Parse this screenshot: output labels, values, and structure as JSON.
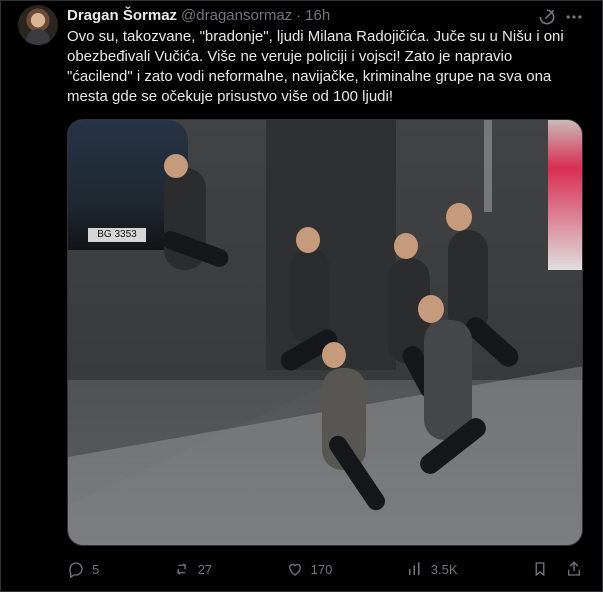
{
  "post": {
    "author_name": "Dragan Šormaz",
    "author_handle": "@dragansormaz",
    "separator": "·",
    "time": "16h",
    "text_lines": [
      "Ovo su, takozvane, \"bradonje\", ljudi Milana Radojičića. Juče su u Nišu i oni",
      "obezbeđivali Vučića. Više ne veruje policiji i vojsci! Zato je napravio",
      "\"ćacilend\" i zato vodi neformalne, navijačke, kriminalne grupe na sva ona",
      "mesta gde se očekuje prisustvo više od 100 ljudi!"
    ],
    "media_plate": "BG 3353"
  },
  "actions": {
    "replies": "5",
    "reposts": "27",
    "likes": "170",
    "views": "3.5K"
  },
  "icons": {
    "grok": "grok-icon",
    "more": "more-icon",
    "reply": "reply-icon",
    "repost": "repost-icon",
    "like": "heart-icon",
    "views": "views-icon",
    "bookmark": "bookmark-icon",
    "share": "share-icon"
  }
}
